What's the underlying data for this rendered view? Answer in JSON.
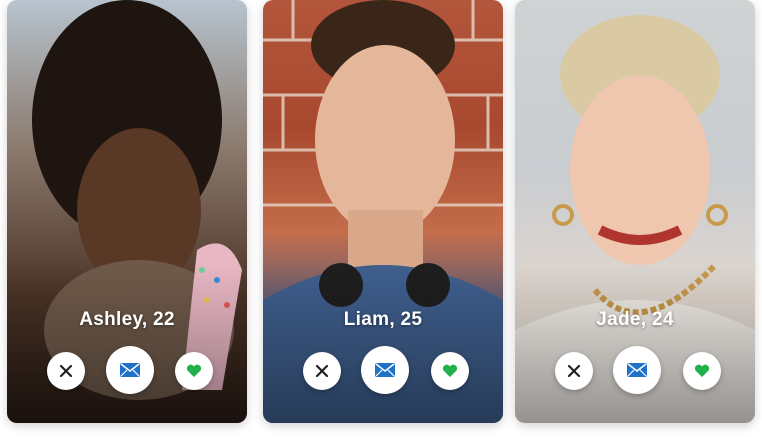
{
  "profiles": [
    {
      "name_age": "Ashley, 22",
      "pass_icon": "close-icon",
      "message_icon": "envelope-icon",
      "like_icon": "heart-icon"
    },
    {
      "name_age": "Liam, 25",
      "pass_icon": "close-icon",
      "message_icon": "envelope-icon",
      "like_icon": "heart-icon"
    },
    {
      "name_age": "Jade, 24",
      "pass_icon": "close-icon",
      "message_icon": "envelope-icon",
      "like_icon": "heart-icon"
    }
  ],
  "colors": {
    "pass_icon": "#222222",
    "message_icon": "#1e73c9",
    "like_icon": "#22b24c",
    "button_bg": "#ffffff"
  }
}
